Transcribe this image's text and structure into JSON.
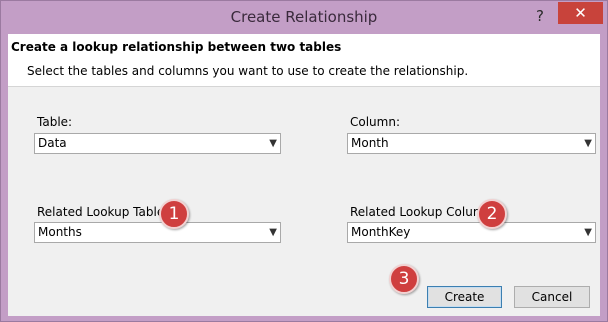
{
  "window": {
    "title": "Create Relationship",
    "help_glyph": "?",
    "close_glyph": "✕"
  },
  "header": {
    "title": "Create a lookup relationship between two tables",
    "subtitle": "Select the tables and columns you want to use to create the relationship."
  },
  "fields": {
    "table": {
      "label": "Table:",
      "value": "Data"
    },
    "column": {
      "label": "Column:",
      "value": "Month"
    },
    "related_table": {
      "label": "Related Lookup Table:",
      "value": "Months"
    },
    "related_column": {
      "label": "Related Lookup Column:",
      "value": "MonthKey"
    }
  },
  "combo_arrow": "▼",
  "badges": [
    "1",
    "2",
    "3"
  ],
  "buttons": {
    "create": "Create",
    "cancel": "Cancel"
  },
  "colors": {
    "titlebar": "#c39ec6",
    "close": "#c8433b",
    "badge": "#cf3f3f"
  }
}
